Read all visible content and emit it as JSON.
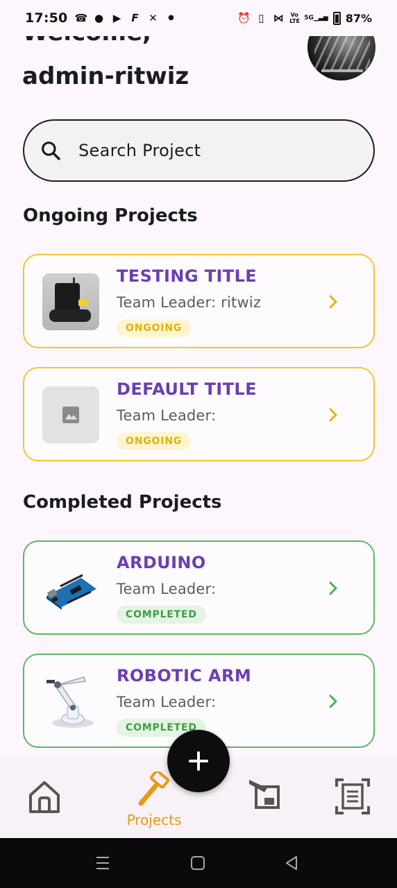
{
  "status_bar": {
    "time": "17:50",
    "battery": "87%",
    "left_icons": [
      "whatsapp-icon",
      "chat-icon",
      "youtube-icon",
      "f-icon",
      "x-icon",
      "dot"
    ],
    "right_icons": [
      "alarm-icon",
      "vibrate-icon",
      "bluetooth-icon",
      "volte-icon",
      "5g-signal-icon",
      "battery-icon"
    ],
    "volte": "Vo LTE",
    "network": "5G"
  },
  "header": {
    "welcome": "Welcome,",
    "username": "admin-ritwiz"
  },
  "search": {
    "placeholder": "Search Project",
    "icon": "search-icon"
  },
  "sections": {
    "ongoing_title": "Ongoing Projects",
    "completed_title": "Completed Projects"
  },
  "ongoing_projects": [
    {
      "title": "TESTING TITLE",
      "leader": "Team Leader: ritwiz",
      "status": "ONGOING",
      "thumb": "robot-photo"
    },
    {
      "title": "DEFAULT TITLE",
      "leader": "Team Leader:",
      "status": "ONGOING",
      "thumb": "image-placeholder-icon"
    }
  ],
  "completed_projects": [
    {
      "title": "ARDUINO",
      "leader": "Team Leader:",
      "status": "COMPLETED",
      "thumb": "arduino-photo"
    },
    {
      "title": "ROBOTIC ARM",
      "leader": "Team Leader:",
      "status": "COMPLETED",
      "thumb": "robotic-arm-photo"
    }
  ],
  "bottom_nav": {
    "items": [
      {
        "name": "home",
        "icon": "home-icon",
        "label": ""
      },
      {
        "name": "projects",
        "icon": "hammer-icon",
        "label": "Projects",
        "active": true
      },
      {
        "name": "assignments",
        "icon": "board-icon",
        "label": ""
      },
      {
        "name": "scanner",
        "icon": "document-scan-icon",
        "label": ""
      }
    ],
    "fab_icon": "plus-icon"
  },
  "colors": {
    "accent_purple": "#6a3fb3",
    "ongoing_yellow": "#f1c62f",
    "completed_green": "#5cb85c",
    "nav_active_orange": "#e69b10",
    "background": "#fdf6fd"
  }
}
